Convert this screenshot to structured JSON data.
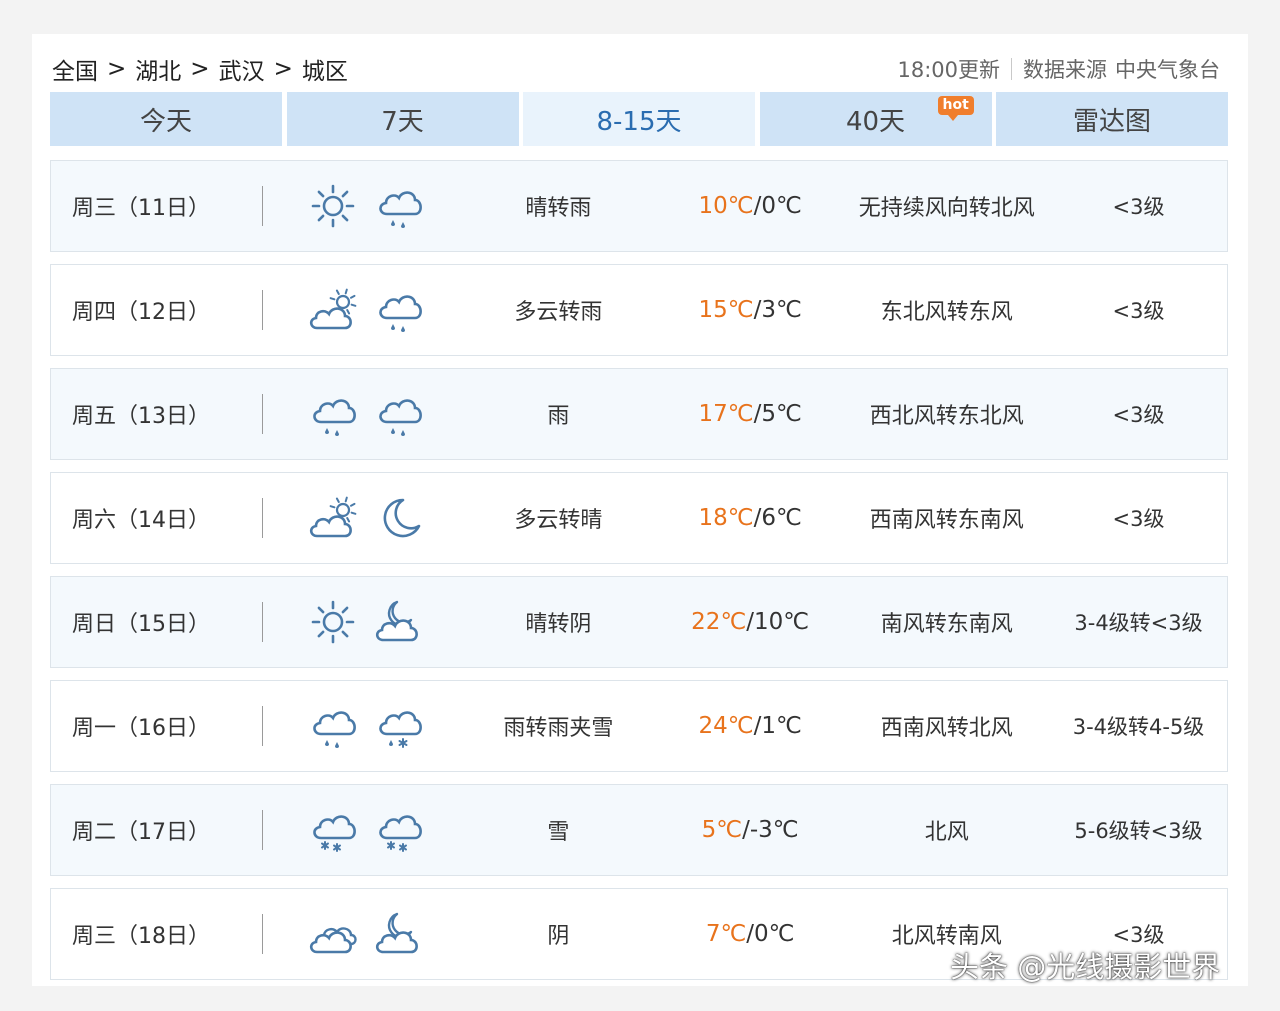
{
  "breadcrumb": [
    "全国",
    "湖北",
    "武汉",
    "城区"
  ],
  "breadcrumb_sep": ">",
  "header": {
    "update": "18:00更新",
    "source_label": "数据来源",
    "source": "中央气象台"
  },
  "tabs": [
    {
      "label": "今天",
      "active": false
    },
    {
      "label": "7天",
      "active": false
    },
    {
      "label": "8-15天",
      "active": true
    },
    {
      "label": "40天",
      "active": false,
      "badge": "hot"
    },
    {
      "label": "雷达图",
      "active": false
    }
  ],
  "colors": {
    "icon": "#4a7aa8",
    "high_temp": "#e8731c",
    "tab": "#cfe3f6",
    "tab_active": "#e9f3fc",
    "hot_badge": "#f07e2d"
  },
  "forecast": [
    {
      "date": "周三（11日）",
      "icons": [
        "sun-icon",
        "cloud-rain-icon"
      ],
      "weather": "晴转雨",
      "high": "10℃",
      "low": "0℃",
      "wind": "无持续风向转北风",
      "level": "<3级"
    },
    {
      "date": "周四（12日）",
      "icons": [
        "partly-cloudy-icon",
        "cloud-rain-icon"
      ],
      "weather": "多云转雨",
      "high": "15℃",
      "low": "3℃",
      "wind": "东北风转东风",
      "level": "<3级"
    },
    {
      "date": "周五（13日）",
      "icons": [
        "cloud-rain-icon",
        "cloud-rain-icon"
      ],
      "weather": "雨",
      "high": "17℃",
      "low": "5℃",
      "wind": "西北风转东北风",
      "level": "<3级"
    },
    {
      "date": "周六（14日）",
      "icons": [
        "partly-cloudy-icon",
        "moon-icon"
      ],
      "weather": "多云转晴",
      "high": "18℃",
      "low": "6℃",
      "wind": "西南风转东南风",
      "level": "<3级"
    },
    {
      "date": "周日（15日）",
      "icons": [
        "sun-icon",
        "cloud-moon-icon"
      ],
      "weather": "晴转阴",
      "high": "22℃",
      "low": "10℃",
      "wind": "南风转东南风",
      "level": "3-4级转<3级"
    },
    {
      "date": "周一（16日）",
      "icons": [
        "cloud-rain-icon",
        "cloud-sleet-icon"
      ],
      "weather": "雨转雨夹雪",
      "high": "24℃",
      "low": "1℃",
      "wind": "西南风转北风",
      "level": "3-4级转4-5级"
    },
    {
      "date": "周二（17日）",
      "icons": [
        "cloud-snow-icon",
        "cloud-snow-icon"
      ],
      "weather": "雪",
      "high": "5℃",
      "low": "-3℃",
      "wind": "北风",
      "level": "5-6级转<3级"
    },
    {
      "date": "周三（18日）",
      "icons": [
        "overcast-icon",
        "cloud-moon-icon"
      ],
      "weather": "阴",
      "high": "7℃",
      "low": "0℃",
      "wind": "北风转南风",
      "level": "<3级"
    }
  ],
  "watermark": "头条 @光线摄影世界"
}
